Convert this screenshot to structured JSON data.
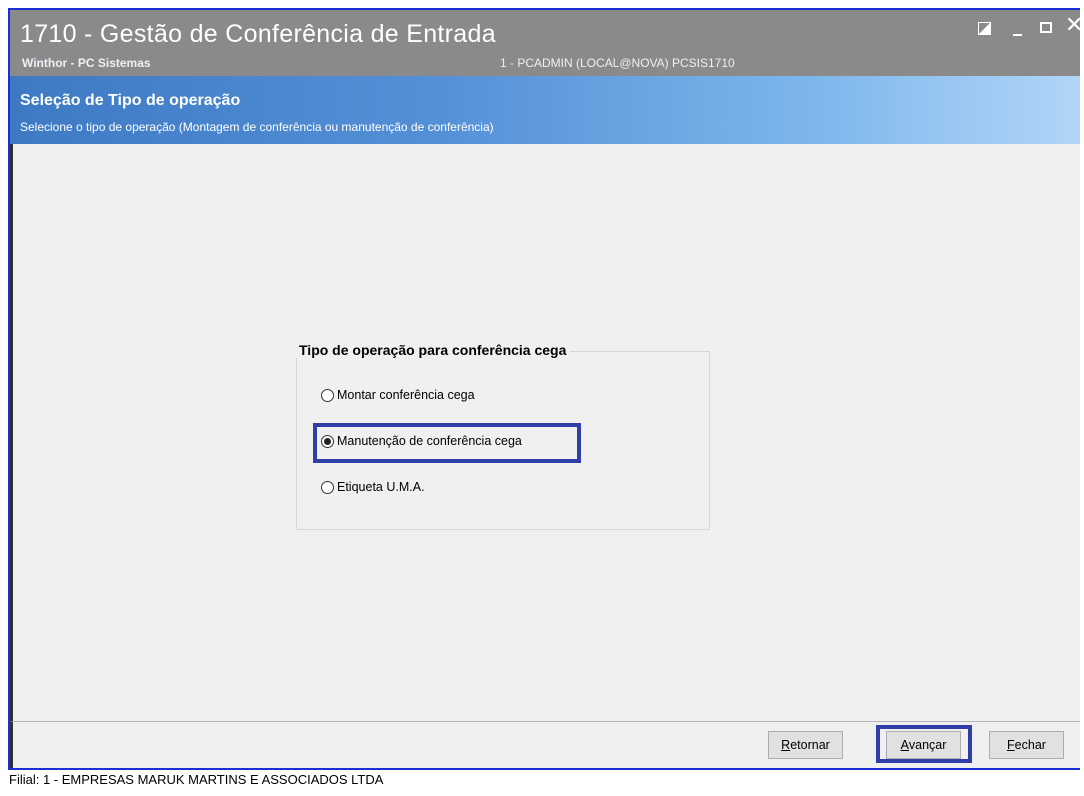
{
  "window": {
    "title": "1710 - Gestão de Conferência de Entrada",
    "subtitle": "Winthor - PC Sistemas",
    "session_info": "1 - PCADMIN (LOCAL@NOVA)   PCSIS1710",
    "controls": {
      "restore_icon": "restore-icon",
      "minimize_icon": "minimize-icon",
      "maximize_icon": "maximize-icon",
      "close_icon": "close-icon"
    }
  },
  "header": {
    "title": "Seleção de Tipo de operação",
    "description": "Selecione o tipo de operação (Montagem de conferência ou manutenção de conferência)"
  },
  "group": {
    "title": "Tipo de operação para conferência cega",
    "options": [
      {
        "label": "Montar conferência cega",
        "checked": false
      },
      {
        "label": "Manutenção de conferência cega",
        "checked": true
      },
      {
        "label": "Etiqueta U.M.A.",
        "checked": false
      }
    ]
  },
  "buttons": {
    "retornar": {
      "mnemonic": "R",
      "rest": "etornar"
    },
    "avancar": {
      "mnemonic": "A",
      "rest": "vançar"
    },
    "fechar": {
      "mnemonic": "F",
      "rest": "echar"
    }
  },
  "status": {
    "filial": "Filial: 1 - EMPRESAS MARUK MARTINS E ASSOCIADOS LTDA"
  },
  "colors": {
    "titlebar": "#8a8a8a",
    "header_start": "#3e7ac4",
    "header_end": "#b1d6f7",
    "highlight_border": "#2f3ea8",
    "window_border": "#1a2fd6"
  }
}
